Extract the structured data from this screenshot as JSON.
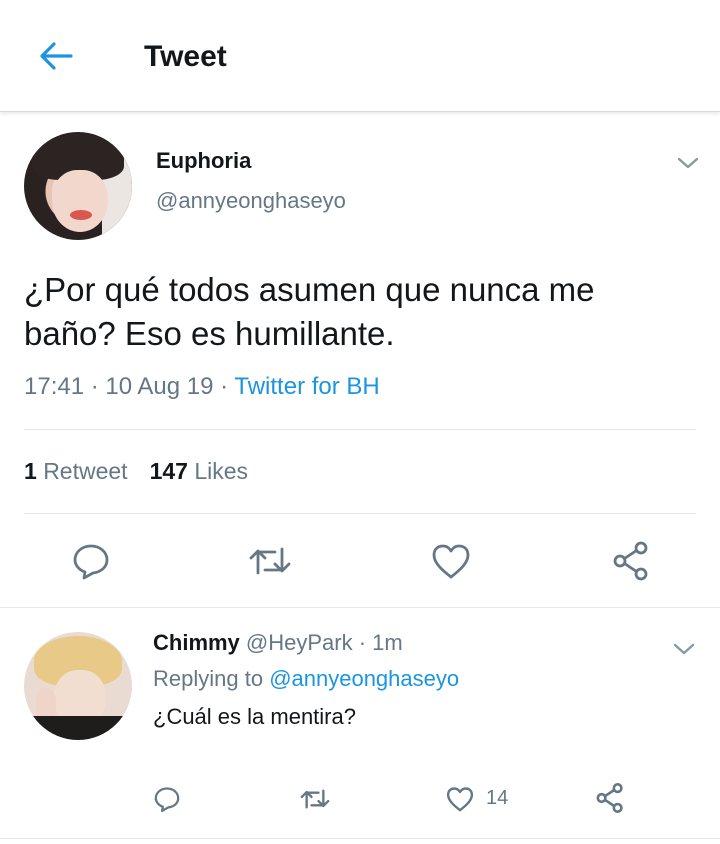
{
  "header": {
    "title": "Tweet"
  },
  "tweet": {
    "author_name": "Euphoria",
    "author_handle": "@annyeonghaseyo",
    "text": "¿Por qué todos asumen que nunca me baño? Eso es humillante.",
    "time": "17:41 · 10 Aug 19 · ",
    "source": "Twitter for BH",
    "retweet_count": "1",
    "retweet_label": "Retweet",
    "like_count": "147",
    "like_label": "Likes"
  },
  "reply": {
    "author_name": "Chimmy",
    "author_handle": "@HeyPark",
    "age": " · 1m",
    "replying_prefix": "Replying to ",
    "replying_to": "@annyeonghaseyo",
    "text": "¿Cuál es la mentira?",
    "like_count": "14"
  },
  "colors": {
    "accent": "#1b95e0",
    "icon": "#657786",
    "text": "#14171a"
  },
  "icons": [
    "back-arrow-icon",
    "chevron-down-icon",
    "reply-icon",
    "retweet-icon",
    "like-icon",
    "share-icon"
  ]
}
